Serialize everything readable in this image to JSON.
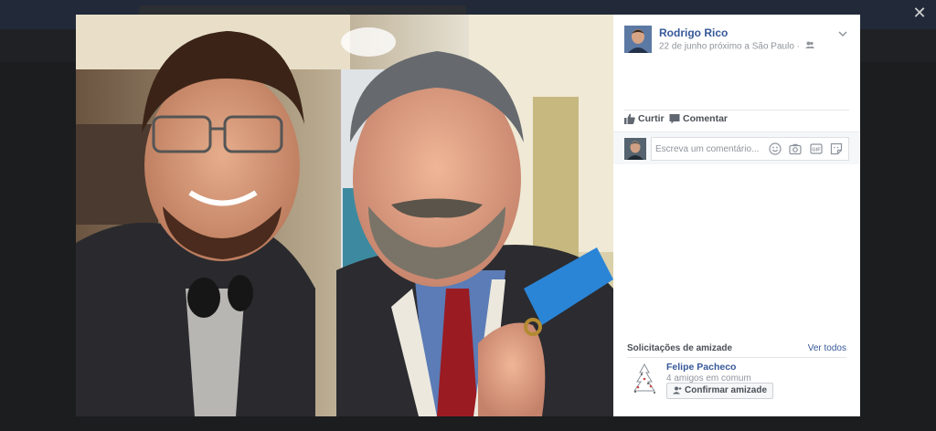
{
  "theater": {
    "close_icon": "close-icon",
    "overlay_color": "#1c1d1f"
  },
  "post": {
    "author": "Rodrigo Rico",
    "meta": "22 de junho próximo a São Paulo ·",
    "audience_icon": "friends-icon",
    "options_icon": "chevron-down-icon"
  },
  "actions": {
    "like_label": "Curtir",
    "comment_label": "Comentar"
  },
  "comment_box": {
    "placeholder": "Escreva um comentário...",
    "icons": [
      "emoji-icon",
      "camera-icon",
      "gif-icon",
      "sticker-icon"
    ]
  },
  "friend_requests": {
    "title": "Solicitações de amizade",
    "see_all": "Ver todos",
    "items": [
      {
        "name": "Felipe Pacheco",
        "mutual": "4 amigos em comum",
        "confirm_label": "Confirmar amizade"
      }
    ]
  },
  "colors": {
    "link": "#365899",
    "secondary_text": "#90949c",
    "action_text": "#4b4f56"
  }
}
